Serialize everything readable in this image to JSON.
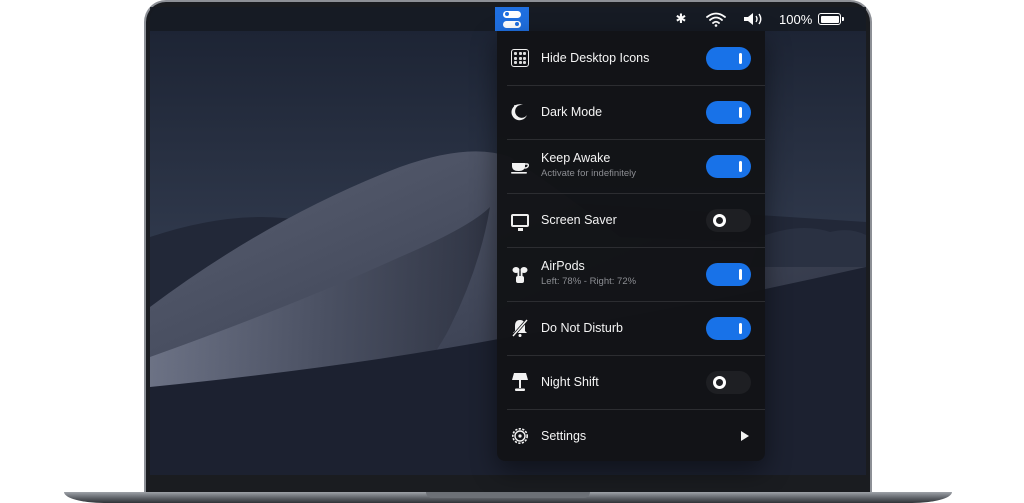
{
  "menubar": {
    "bluetooth_glyph": "✱",
    "battery_percent": "100%"
  },
  "panel": {
    "rows": [
      {
        "title": "Hide Desktop Icons",
        "subtitle": "",
        "icon": "desktop-icons-grid-icon",
        "control": "toggle",
        "state": "on"
      },
      {
        "title": "Dark Mode",
        "subtitle": "",
        "icon": "moon-icon",
        "control": "toggle",
        "state": "on"
      },
      {
        "title": "Keep Awake",
        "subtitle": "Activate for indefinitely",
        "icon": "coffee-cup-icon",
        "control": "toggle",
        "state": "on"
      },
      {
        "title": "Screen Saver",
        "subtitle": "",
        "icon": "monitor-icon",
        "control": "toggle",
        "state": "off"
      },
      {
        "title": "AirPods",
        "subtitle": "Left: 78% - Right: 72%",
        "icon": "airpods-icon",
        "control": "toggle",
        "state": "on"
      },
      {
        "title": "Do Not Disturb",
        "subtitle": "",
        "icon": "bell-slash-icon",
        "control": "toggle",
        "state": "on"
      },
      {
        "title": "Night Shift",
        "subtitle": "",
        "icon": "lamp-icon",
        "control": "toggle",
        "state": "off"
      },
      {
        "title": "Settings",
        "subtitle": "",
        "icon": "gear-icon",
        "control": "chevron",
        "state": ""
      }
    ]
  },
  "colors": {
    "accent": "#1872e8",
    "panel_bg": "#121316",
    "app_icon_bg": "#1f6fe0"
  }
}
